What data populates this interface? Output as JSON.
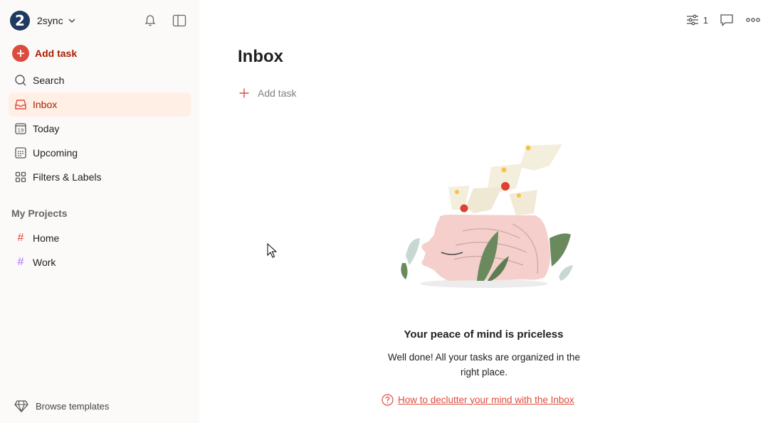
{
  "account": {
    "name": "2sync",
    "avatar_letter": "2"
  },
  "sidebar": {
    "add_task_label": "Add task",
    "items": [
      {
        "label": "Search",
        "icon": "search-icon"
      },
      {
        "label": "Inbox",
        "icon": "inbox-icon",
        "active": true
      },
      {
        "label": "Today",
        "icon": "calendar-today-icon",
        "day": "19"
      },
      {
        "label": "Upcoming",
        "icon": "calendar-grid-icon"
      },
      {
        "label": "Filters & Labels",
        "icon": "grid-icon"
      }
    ],
    "projects_title": "My Projects",
    "projects": [
      {
        "label": "Home",
        "color": "#dc4c3e"
      },
      {
        "label": "Work",
        "color": "#a970ff"
      }
    ],
    "browse_templates": "Browse templates"
  },
  "header": {
    "view_count": "1"
  },
  "main": {
    "title": "Inbox",
    "add_task_label": "Add task",
    "empty_title": "Your peace of mind is priceless",
    "empty_text": "Well done! All your tasks are organized in the right place.",
    "help_link": "How to declutter your mind with the Inbox"
  },
  "colors": {
    "accent": "#dc4c3e",
    "active_bg": "#ffefe5",
    "active_text": "#a81f00"
  }
}
